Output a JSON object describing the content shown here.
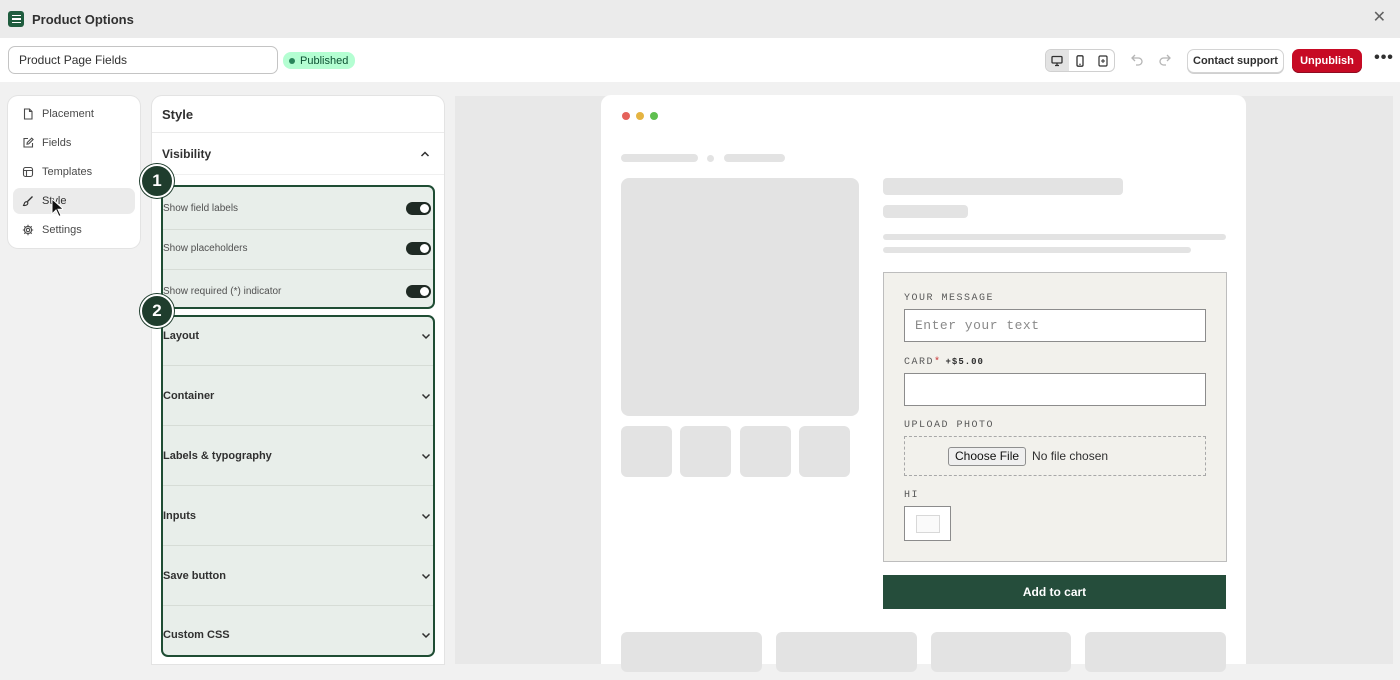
{
  "window": {
    "title": "Product Options",
    "close_glyph": "✕"
  },
  "toolbar": {
    "name_value": "Product Page Fields",
    "status_badge": "Published",
    "contact_support": "Contact support",
    "unpublish": "Unpublish",
    "more_glyph": "•••"
  },
  "sidebar": {
    "items": [
      {
        "label": "Placement",
        "icon": "page-icon"
      },
      {
        "label": "Fields",
        "icon": "edit-icon"
      },
      {
        "label": "Templates",
        "icon": "template-icon"
      },
      {
        "label": "Style",
        "icon": "brush-icon",
        "active": true
      },
      {
        "label": "Settings",
        "icon": "gear-icon"
      }
    ]
  },
  "style_panel": {
    "title": "Style",
    "visibility": {
      "label": "Visibility",
      "toggles": [
        {
          "label": "Show field labels",
          "on": true
        },
        {
          "label": "Show placeholders",
          "on": true
        },
        {
          "label": "Show required (*) indicator",
          "on": true
        }
      ]
    },
    "sections": [
      "Layout",
      "Container",
      "Labels & typography",
      "Inputs",
      "Save button",
      "Custom CSS"
    ]
  },
  "annotations": {
    "badge_1": "1",
    "badge_2": "2"
  },
  "preview": {
    "fields": {
      "message_label": "YOUR MESSAGE",
      "message_placeholder": "Enter your text",
      "card_label": "CARD",
      "card_required": "*",
      "card_price": "+$5.00",
      "upload_label": "UPLOAD PHOTO",
      "choose_file": "Choose File",
      "no_file": "No file chosen",
      "hi_label": "HI"
    },
    "add_to_cart": "Add to cart"
  },
  "colors": {
    "brand_green": "#254d3b",
    "unpublish_red": "#c70a24",
    "published_bg": "#b4fed2"
  }
}
